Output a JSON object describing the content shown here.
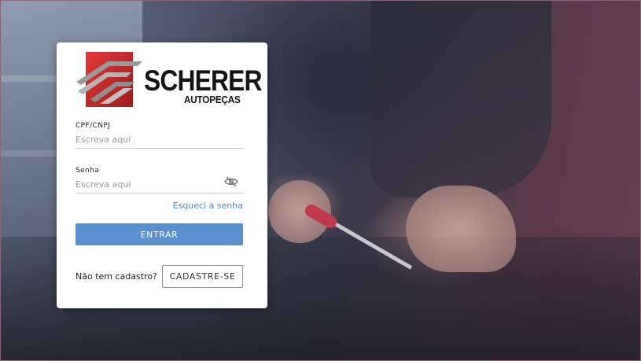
{
  "brand": {
    "name": "SCHERER",
    "tagline": "AUTOPEÇAS",
    "logo_color": "#c62a2a"
  },
  "form": {
    "cpf_label": "CPF/CNPJ",
    "cpf_placeholder": "Escreva aqui",
    "password_label": "Senha",
    "password_placeholder": "Escreva aqui",
    "password_toggle_icon": "eye-off-icon",
    "forgot_link": "Esqueci a senha",
    "submit_label": "ENTRAR"
  },
  "signup": {
    "prompt": "Não tem cadastro?",
    "button_label": "CADASTRE-SE"
  },
  "colors": {
    "primary": "#5b8fd0",
    "link": "#4a86c8"
  }
}
